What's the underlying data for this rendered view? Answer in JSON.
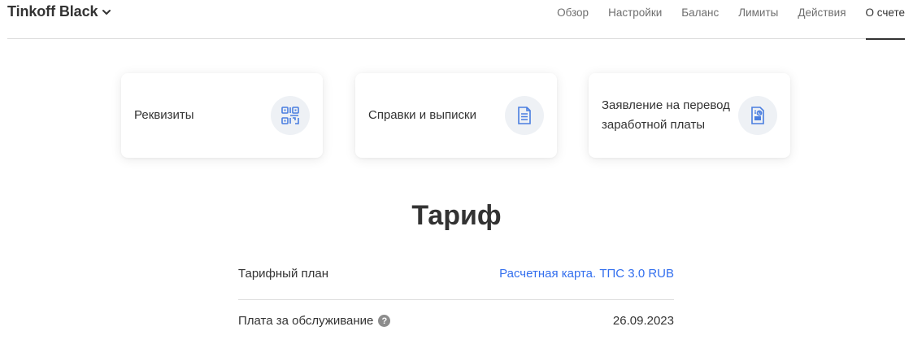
{
  "header": {
    "product_title": "Tinkoff Black",
    "nav": [
      {
        "label": "Обзор",
        "active": false
      },
      {
        "label": "Настройки",
        "active": false
      },
      {
        "label": "Баланс",
        "active": false
      },
      {
        "label": "Лимиты",
        "active": false
      },
      {
        "label": "Действия",
        "active": false
      },
      {
        "label": "О счете",
        "active": true
      }
    ]
  },
  "cards": [
    {
      "label": "Реквизиты",
      "icon": "qr-code-icon"
    },
    {
      "label": "Справки и выписки",
      "icon": "document-list-icon"
    },
    {
      "label": "Заявление на перевод заработной платы",
      "icon": "salary-document-icon"
    }
  ],
  "tariff": {
    "title": "Тариф",
    "rows": [
      {
        "label": "Тарифный план",
        "value": "Расчетная карта. ТПС 3.0 RUB"
      },
      {
        "label": "Плата за обслуживание",
        "value": "26.09.2023"
      }
    ]
  },
  "colors": {
    "accent": "#336fee",
    "text": "#333333",
    "muted": "#6e6e6e",
    "icon_bg": "#eef1f5",
    "icon_blue": "#4a7ee0"
  }
}
